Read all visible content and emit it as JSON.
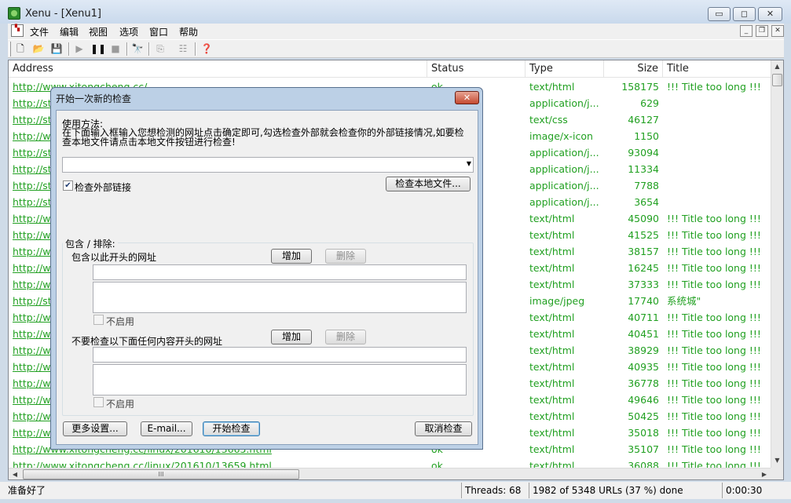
{
  "window": {
    "title": "Xenu - [Xenu1]",
    "minimize": "▭",
    "maximize": "◻",
    "close": "✕"
  },
  "menubar": {
    "items": [
      "文件",
      "编辑",
      "视图",
      "选项",
      "窗口",
      "帮助"
    ],
    "mdi_minimize": "_",
    "mdi_restore": "❐",
    "mdi_close": "✕"
  },
  "toolbar": {
    "icons": [
      "new-icon",
      "open-icon",
      "save-icon",
      "play-icon",
      "pause-icon",
      "stop-icon",
      "find-icon",
      "copy-icon",
      "properties-icon",
      "help-icon"
    ]
  },
  "table": {
    "columns": {
      "address": "Address",
      "status": "Status",
      "type": "Type",
      "size": "Size",
      "title": "Title"
    },
    "rows": [
      {
        "address": "http://www.xitongcheng.cc/",
        "status": "ok",
        "type": "text/html",
        "size": "158175",
        "title": "!!! Title too long !!!"
      },
      {
        "address": "http://sta",
        "status": "",
        "type": "application/j...",
        "size": "629",
        "title": ""
      },
      {
        "address": "http://sta",
        "status": "",
        "type": "text/css",
        "size": "46127",
        "title": ""
      },
      {
        "address": "http://ww",
        "status": "",
        "type": "image/x-icon",
        "size": "1150",
        "title": ""
      },
      {
        "address": "http://sta",
        "status": "",
        "type": "application/j...",
        "size": "93094",
        "title": ""
      },
      {
        "address": "http://sta",
        "status": "",
        "type": "application/j...",
        "size": "11334",
        "title": ""
      },
      {
        "address": "http://sta",
        "status": "",
        "type": "application/j...",
        "size": "7788",
        "title": ""
      },
      {
        "address": "http://sta",
        "status": "",
        "type": "application/j...",
        "size": "3654",
        "title": ""
      },
      {
        "address": "http://ww",
        "status": "",
        "type": "text/html",
        "size": "45090",
        "title": "!!! Title too long !!!"
      },
      {
        "address": "http://ww",
        "status": "",
        "type": "text/html",
        "size": "41525",
        "title": "!!! Title too long !!!"
      },
      {
        "address": "http://ww",
        "status": "",
        "type": "text/html",
        "size": "38157",
        "title": "!!! Title too long !!!"
      },
      {
        "address": "http://ww",
        "status": "",
        "type": "text/html",
        "size": "16245",
        "title": "!!! Title too long !!!"
      },
      {
        "address": "http://ww",
        "status": "",
        "type": "text/html",
        "size": "37333",
        "title": "!!! Title too long !!!"
      },
      {
        "address": "http://sta",
        "status": "",
        "type": "image/jpeg",
        "size": "17740",
        "title": "系统城\""
      },
      {
        "address": "http://ww",
        "status": "",
        "type": "text/html",
        "size": "40711",
        "title": "!!! Title too long !!!"
      },
      {
        "address": "http://ww",
        "status": "",
        "type": "text/html",
        "size": "40451",
        "title": "!!! Title too long !!!"
      },
      {
        "address": "http://ww",
        "status": "",
        "type": "text/html",
        "size": "38929",
        "title": "!!! Title too long !!!"
      },
      {
        "address": "http://ww",
        "status": "",
        "type": "text/html",
        "size": "40935",
        "title": "!!! Title too long !!!"
      },
      {
        "address": "http://ww",
        "status": "",
        "type": "text/html",
        "size": "36778",
        "title": "!!! Title too long !!!"
      },
      {
        "address": "http://ww",
        "status": "",
        "type": "text/html",
        "size": "49646",
        "title": "!!! Title too long !!!"
      },
      {
        "address": "http://ww",
        "status": "",
        "type": "text/html",
        "size": "50425",
        "title": "!!! Title too long !!!"
      },
      {
        "address": "http://ww",
        "status": "",
        "type": "text/html",
        "size": "35018",
        "title": "!!! Title too long !!!"
      },
      {
        "address": "http://www.xitongcheng.cc/linux/201610/13665.html",
        "status": "ok",
        "type": "text/html",
        "size": "35107",
        "title": "!!! Title too long !!!"
      },
      {
        "address": "http://www.xitongcheng.cc/linux/201610/13659.html",
        "status": "ok",
        "type": "text/html",
        "size": "36088",
        "title": "!!! Title too long !!!"
      }
    ]
  },
  "scrollbars": {
    "up": "▲",
    "down": "▼",
    "left": "◀",
    "right": "▶",
    "grip": "III"
  },
  "statusbar": {
    "ready": "准备好了",
    "threads": "Threads: 68",
    "progress": "1982 of 5348 URLs (37 %) done",
    "progress_percent": 37,
    "elapsed": "0:00:30"
  },
  "dialog": {
    "title": "开始一次新的检查",
    "close": "✕",
    "usage_label": "使用方法:",
    "usage_line1": "在下面输入框输入您想检测的网址点击确定即可,勾选检查外部就会检查你的外部链接情况,如要检",
    "usage_line2": "查本地文件请点击本地文件按钮进行检查!",
    "url_value": "",
    "check_external": "检查外部链接",
    "check_local": "检查本地文件...",
    "group_label": "包含 / 排除:",
    "include_label": "包含以此开头的网址",
    "include_add": "增加",
    "include_delete": "删除",
    "include_disable": "不启用",
    "exclude_label": "不要检查以下面任何内容开头的网址",
    "exclude_add": "增加",
    "exclude_delete": "删除",
    "exclude_disable": "不启用",
    "more_settings": "更多设置...",
    "email": "E-mail...",
    "start_check": "开始检查",
    "cancel_check": "取消检查"
  }
}
